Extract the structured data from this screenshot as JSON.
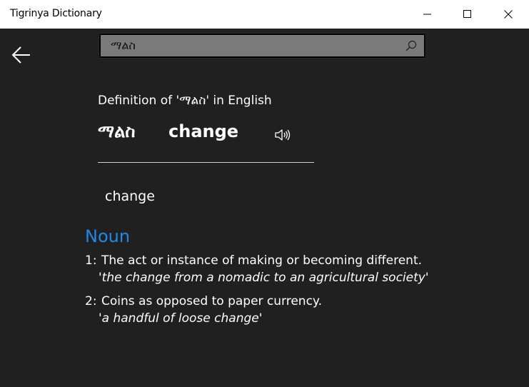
{
  "window": {
    "title": "Tigrinya Dictionary"
  },
  "search": {
    "value": "ማልስ",
    "placeholder": ""
  },
  "entry": {
    "heading": "Definition of 'ማልስ' in English",
    "source_word": "ማልስ",
    "target_word": "change",
    "translation": "change",
    "part_of_speech": "Noun",
    "senses": [
      {
        "number": "1:",
        "definition": "The act or instance of making or becoming different.",
        "example": "'the change from a nomadic to an agricultural society'"
      },
      {
        "number": "2:",
        "definition": "Coins as opposed to paper currency.",
        "example": "'a handful of loose change'"
      }
    ]
  },
  "icons": {
    "back": "arrow-left-icon",
    "search": "search-icon",
    "speaker": "speaker-icon",
    "minimize": "minimize-icon",
    "maximize": "maximize-icon",
    "close": "close-icon"
  },
  "colors": {
    "background": "#202020",
    "titlebar": "#ffffff",
    "accent": "#1e8ae6",
    "search_box": "#7a7a7a"
  }
}
